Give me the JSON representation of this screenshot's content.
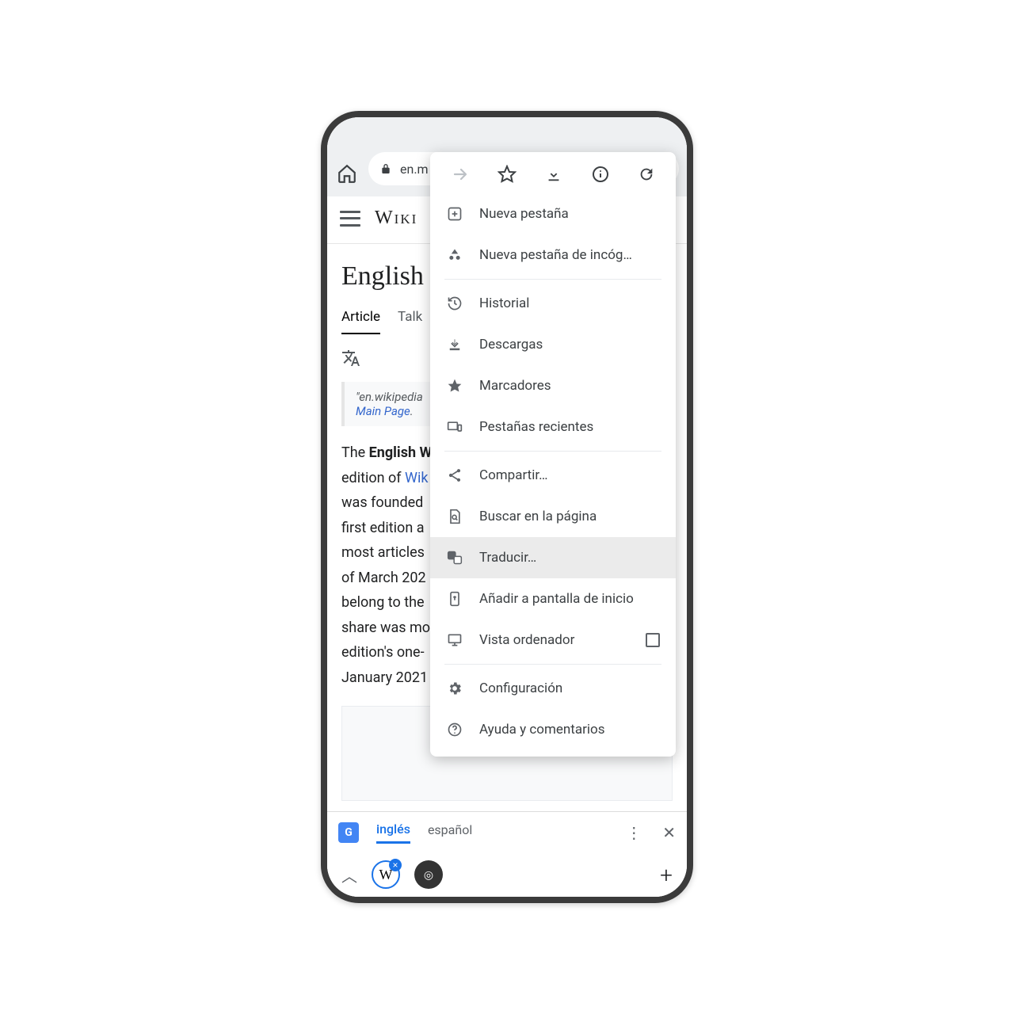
{
  "url": "en.m",
  "wiki_logo": "Wiki",
  "article_title": "English",
  "tabs": {
    "article": "Article",
    "talk": "Talk"
  },
  "redirect": {
    "text": "\"en.wikipedia",
    "link": "Main Page",
    "period": "."
  },
  "paragraph": {
    "pre": "The ",
    "bold": "English W",
    "line2a": "edition of ",
    "wiki_link": "Wik",
    "line3": "was founded",
    "line4": "first edition a",
    "line5": "most articles",
    "line6": "of March 202",
    "line7": "belong to the",
    "line8": "share was mo",
    "line9": "edition's one-",
    "line10": "January 2021"
  },
  "menu": {
    "new_tab": "Nueva pestaña",
    "incognito": "Nueva pestaña de incóg…",
    "history": "Historial",
    "downloads": "Descargas",
    "bookmarks": "Marcadores",
    "recent_tabs": "Pestañas recientes",
    "share": "Compartir…",
    "find": "Buscar en la página",
    "translate": "Traducir…",
    "add_home": "Añadir a pantalla de inicio",
    "desktop": "Vista ordenador",
    "settings": "Configuración",
    "help": "Ayuda y comentarios"
  },
  "translate_bar": {
    "lang1": "inglés",
    "lang2": "español"
  },
  "tab_chip_letter": "W"
}
